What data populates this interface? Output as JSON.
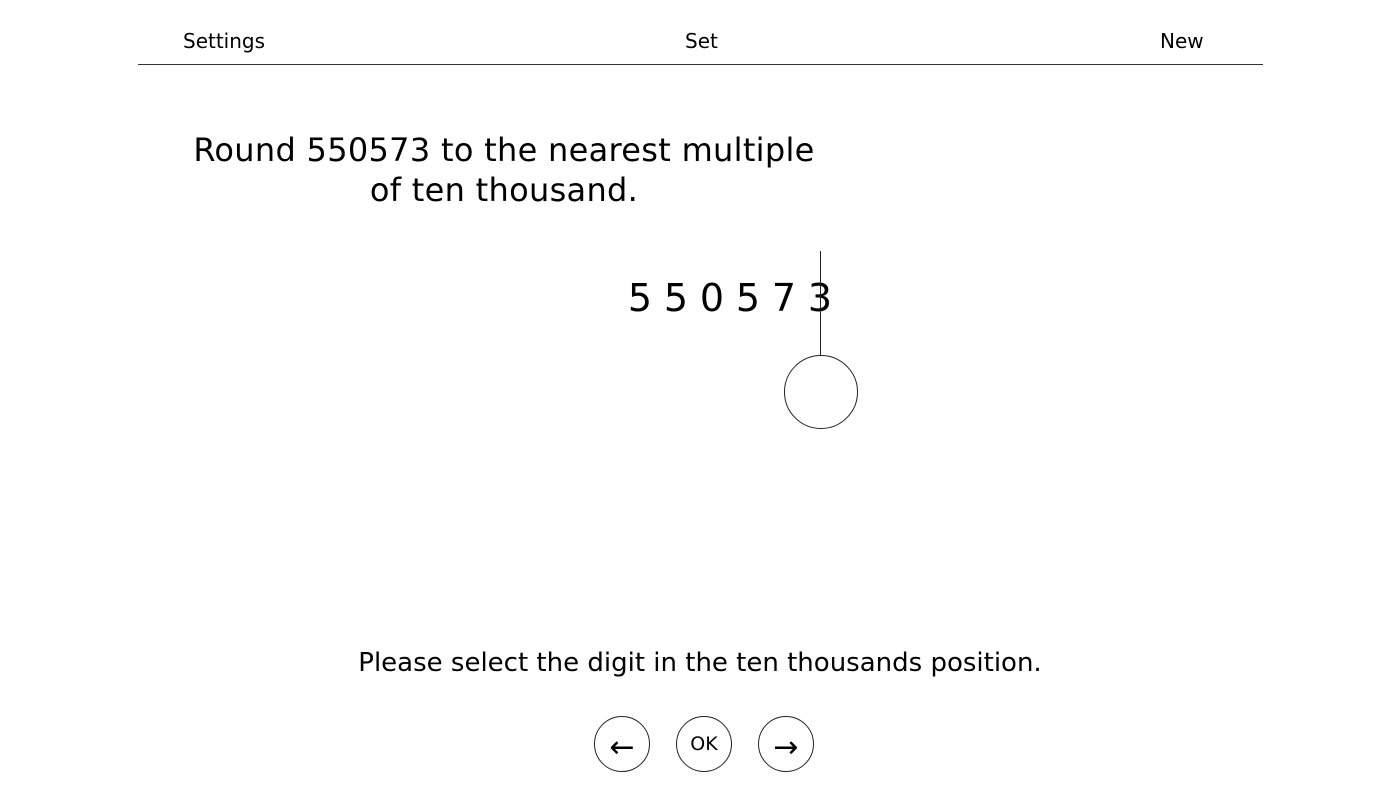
{
  "nav": {
    "settings_label": "Settings",
    "set_label": "Set",
    "new_label": "New"
  },
  "question": {
    "text": "Round 550573 to the nearest multiple of ten thousand."
  },
  "number": {
    "digits": [
      "5",
      "5",
      "0",
      "5",
      "7",
      "3"
    ]
  },
  "instruction": {
    "text": "Please select the digit in the ten thousands position."
  },
  "controls": {
    "prev_label": "←",
    "ok_label": "OK",
    "next_label": "→"
  }
}
